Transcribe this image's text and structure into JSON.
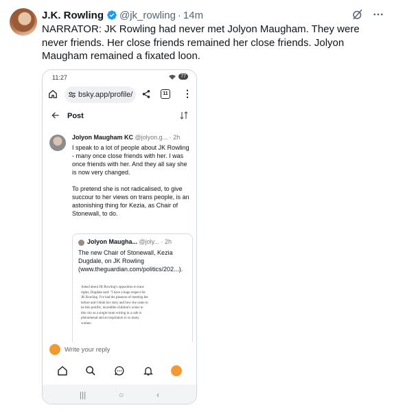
{
  "tweet": {
    "author_name": "J.K. Rowling",
    "handle": "@jk_rowling",
    "separator": "·",
    "time": "14m",
    "text": "NARRATOR: JK Rowling had never met Jolyon Maugham. They were never friends. Her close friends remained her close friends. Jolyon Maugham remained a fixated loon.",
    "icons": [
      "verified-badge",
      "grok-icon",
      "more-icon"
    ]
  },
  "screenshot": {
    "status_time": "11:27",
    "battery": "77",
    "url": "bsky.app/profile/",
    "tab_count": "11",
    "page_title": "Post",
    "post": {
      "author": "Jolyon Maugham KC",
      "handle": "@jolyon.g...",
      "time": "· 2h",
      "paragraph1": "I speak to a lot of people about JK Rowling - many once close friends with her. I was once friends with her. And they all say she is now very changed.",
      "paragraph2": "To pretend she is not radicalised, to give succour to her views on trans people, is an astonishing thing for Kezia, as Chair of Stonewall, to do."
    },
    "quote": {
      "author": "Jolyon Maugha...",
      "handle": "@joly...",
      "time": "· 2h",
      "text": "The new Chair of Stonewall, Kezia Dugdale, on JK Rowling (www.theguardian.com/politics/202...).",
      "image_text": "Asked about JK Rowling's opposition to trans rights, Dugdale said: \"I have a huge respect for JK Rowling. I've had the pleasure of meeting her before and I think her story and how she came to be this prolific, incredible children's writer in this city as a single mum writing in a cafe is phenomenal and an inspiration to so many women"
    },
    "reply_placeholder": "Write your reply",
    "nav_icons": [
      "home-icon",
      "search-icon",
      "chat-icon",
      "bell-icon",
      "notification-avatar"
    ],
    "system_nav": [
      "|||",
      "○",
      "‹"
    ]
  }
}
